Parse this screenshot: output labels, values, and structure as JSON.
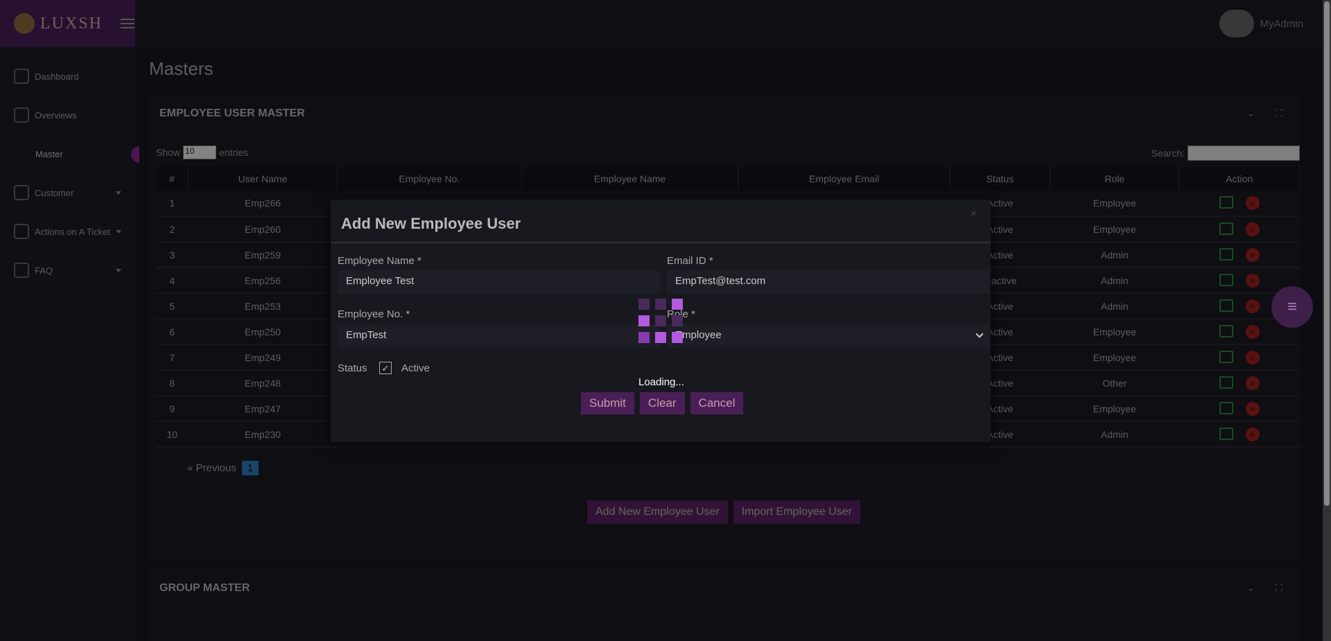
{
  "app": {
    "logo_text": "LUXSH",
    "user_name": "MyAdmin"
  },
  "sidebar": {
    "items": [
      {
        "label": "Dashboard"
      },
      {
        "label": "Overviews"
      },
      {
        "label": "Master"
      },
      {
        "label": "Customer"
      },
      {
        "label": "Actions on A Ticket"
      },
      {
        "label": "FAQ"
      }
    ]
  },
  "page": {
    "title": "Masters"
  },
  "card": {
    "title": "EMPLOYEE USER MASTER",
    "show_label": "Show",
    "entries_value": "10",
    "entries_label": "entries",
    "search_label": "Search:",
    "columns": [
      "#",
      "User Name",
      "Employee No.",
      "Employee Name",
      "Employee Email",
      "Status",
      "Role",
      "Action"
    ],
    "rows": [
      {
        "n": "1",
        "user": "Emp266",
        "status": "Active",
        "role": "Employee"
      },
      {
        "n": "2",
        "user": "Emp260",
        "status": "Active",
        "role": "Employee"
      },
      {
        "n": "3",
        "user": "Emp259",
        "status": "Active",
        "role": "Admin"
      },
      {
        "n": "4",
        "user": "Emp256",
        "status": "Inactive",
        "role": "Admin"
      },
      {
        "n": "5",
        "user": "Emp253",
        "status": "Active",
        "role": "Admin"
      },
      {
        "n": "6",
        "user": "Emp250",
        "status": "Active",
        "role": "Employee"
      },
      {
        "n": "7",
        "user": "Emp249",
        "status": "Active",
        "role": "Employee"
      },
      {
        "n": "8",
        "user": "Emp248",
        "status": "Active",
        "role": "Other"
      },
      {
        "n": "9",
        "user": "Emp247",
        "status": "Active",
        "role": "Employee"
      },
      {
        "n": "10",
        "user": "Emp230",
        "status": "Active",
        "role": "Admin"
      }
    ],
    "pager": {
      "prev": "« Previous",
      "page": "1"
    },
    "add_button": "Add New Employee User",
    "import_button": "Import Employee User"
  },
  "card2": {
    "title": "GROUP MASTER"
  },
  "modal": {
    "title": "Add New Employee User",
    "close": "×",
    "employee_name_label": "Employee Name *",
    "employee_name_value": "Employee Test",
    "email_label": "Email ID *",
    "email_value": "EmpTest@test.com",
    "employee_no_label": "Employee No. *",
    "employee_no_value": "EmpTest",
    "role_label": "Role *",
    "role_value": "Employee",
    "status_label": "Status",
    "active_label": "Active",
    "submit": "Submit",
    "clear": "Clear",
    "cancel": "Cancel"
  },
  "loading": {
    "text": "Loading..."
  },
  "colors": {
    "accent": "#b35ae0",
    "brand": "#4a1f58"
  }
}
